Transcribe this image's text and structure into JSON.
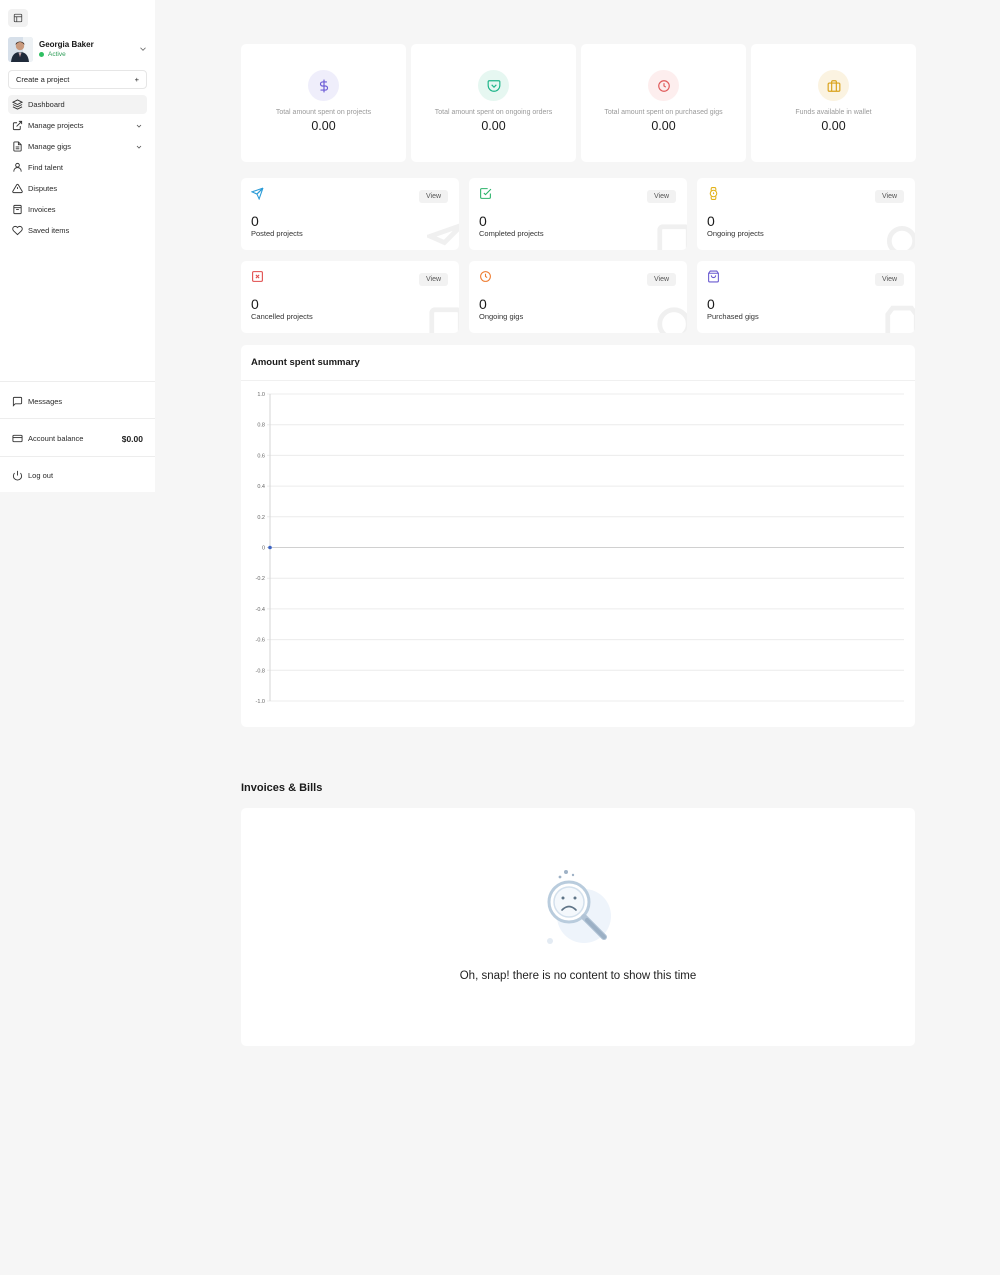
{
  "sidebar": {
    "user": {
      "name": "Georgia Baker",
      "status": "Active"
    },
    "create_label": "Create a project",
    "create_plus": "+",
    "items": [
      {
        "label": "Dashboard",
        "icon": "layers-icon",
        "active": true
      },
      {
        "label": "Manage projects",
        "icon": "external-link-icon",
        "dropdown": true
      },
      {
        "label": "Manage gigs",
        "icon": "document-icon",
        "dropdown": true
      },
      {
        "label": "Find talent",
        "icon": "user-icon"
      },
      {
        "label": "Disputes",
        "icon": "warning-icon"
      },
      {
        "label": "Invoices",
        "icon": "invoice-icon"
      },
      {
        "label": "Saved items",
        "icon": "heart-icon"
      }
    ],
    "messages_label": "Messages",
    "balance_label": "Account balance",
    "balance_value": "$0.00",
    "logout_label": "Log out"
  },
  "stats": [
    {
      "label": "Total amount spent on projects",
      "value": "0.00",
      "icon": "dollar-icon",
      "color": "#6b5bd6",
      "bg": "#efeefb"
    },
    {
      "label": "Total amount spent on ongoing orders",
      "value": "0.00",
      "icon": "pocket-icon",
      "color": "#1fb58a",
      "bg": "#e6f7f1"
    },
    {
      "label": "Total amount spent on purchased gigs",
      "value": "0.00",
      "icon": "clock-icon",
      "color": "#e05b5b",
      "bg": "#fdeeee"
    },
    {
      "label": "Funds available in wallet",
      "value": "0.00",
      "icon": "briefcase-icon",
      "color": "#d9a21b",
      "bg": "#fbf3e1"
    }
  ],
  "mini_cards": [
    {
      "count": "0",
      "label": "Posted projects",
      "view": "View",
      "icon": "send-icon",
      "color": "#2a9bd7"
    },
    {
      "count": "0",
      "label": "Completed projects",
      "view": "View",
      "icon": "check-square-icon",
      "color": "#2bb36a"
    },
    {
      "count": "0",
      "label": "Ongoing projects",
      "view": "View",
      "icon": "watch-icon",
      "color": "#e2b21a"
    },
    {
      "count": "0",
      "label": "Cancelled projects",
      "view": "View",
      "icon": "x-square-icon",
      "color": "#e04a4a"
    },
    {
      "count": "0",
      "label": "Ongoing gigs",
      "view": "View",
      "icon": "clock-icon",
      "color": "#ee7b2f"
    },
    {
      "count": "0",
      "label": "Purchased gigs",
      "view": "View",
      "icon": "shopping-bag-icon",
      "color": "#6a5ad0"
    }
  ],
  "chart_title": "Amount spent summary",
  "chart_data": {
    "type": "line",
    "title": "Amount spent summary",
    "xlabel": "",
    "ylabel": "",
    "ylim": [
      -1.0,
      1.0
    ],
    "yticks": [
      "1.0",
      "0.8",
      "0.6",
      "0.4",
      "0.2",
      "0",
      "-0.2",
      "-0.4",
      "-0.6",
      "-0.8",
      "-1.0"
    ],
    "series": [
      {
        "values": [
          0
        ]
      }
    ],
    "grid": true,
    "color": "#3b63c4"
  },
  "invoices": {
    "title": "Invoices & Bills",
    "empty_text": "Oh, snap! there is no content to show this time"
  }
}
